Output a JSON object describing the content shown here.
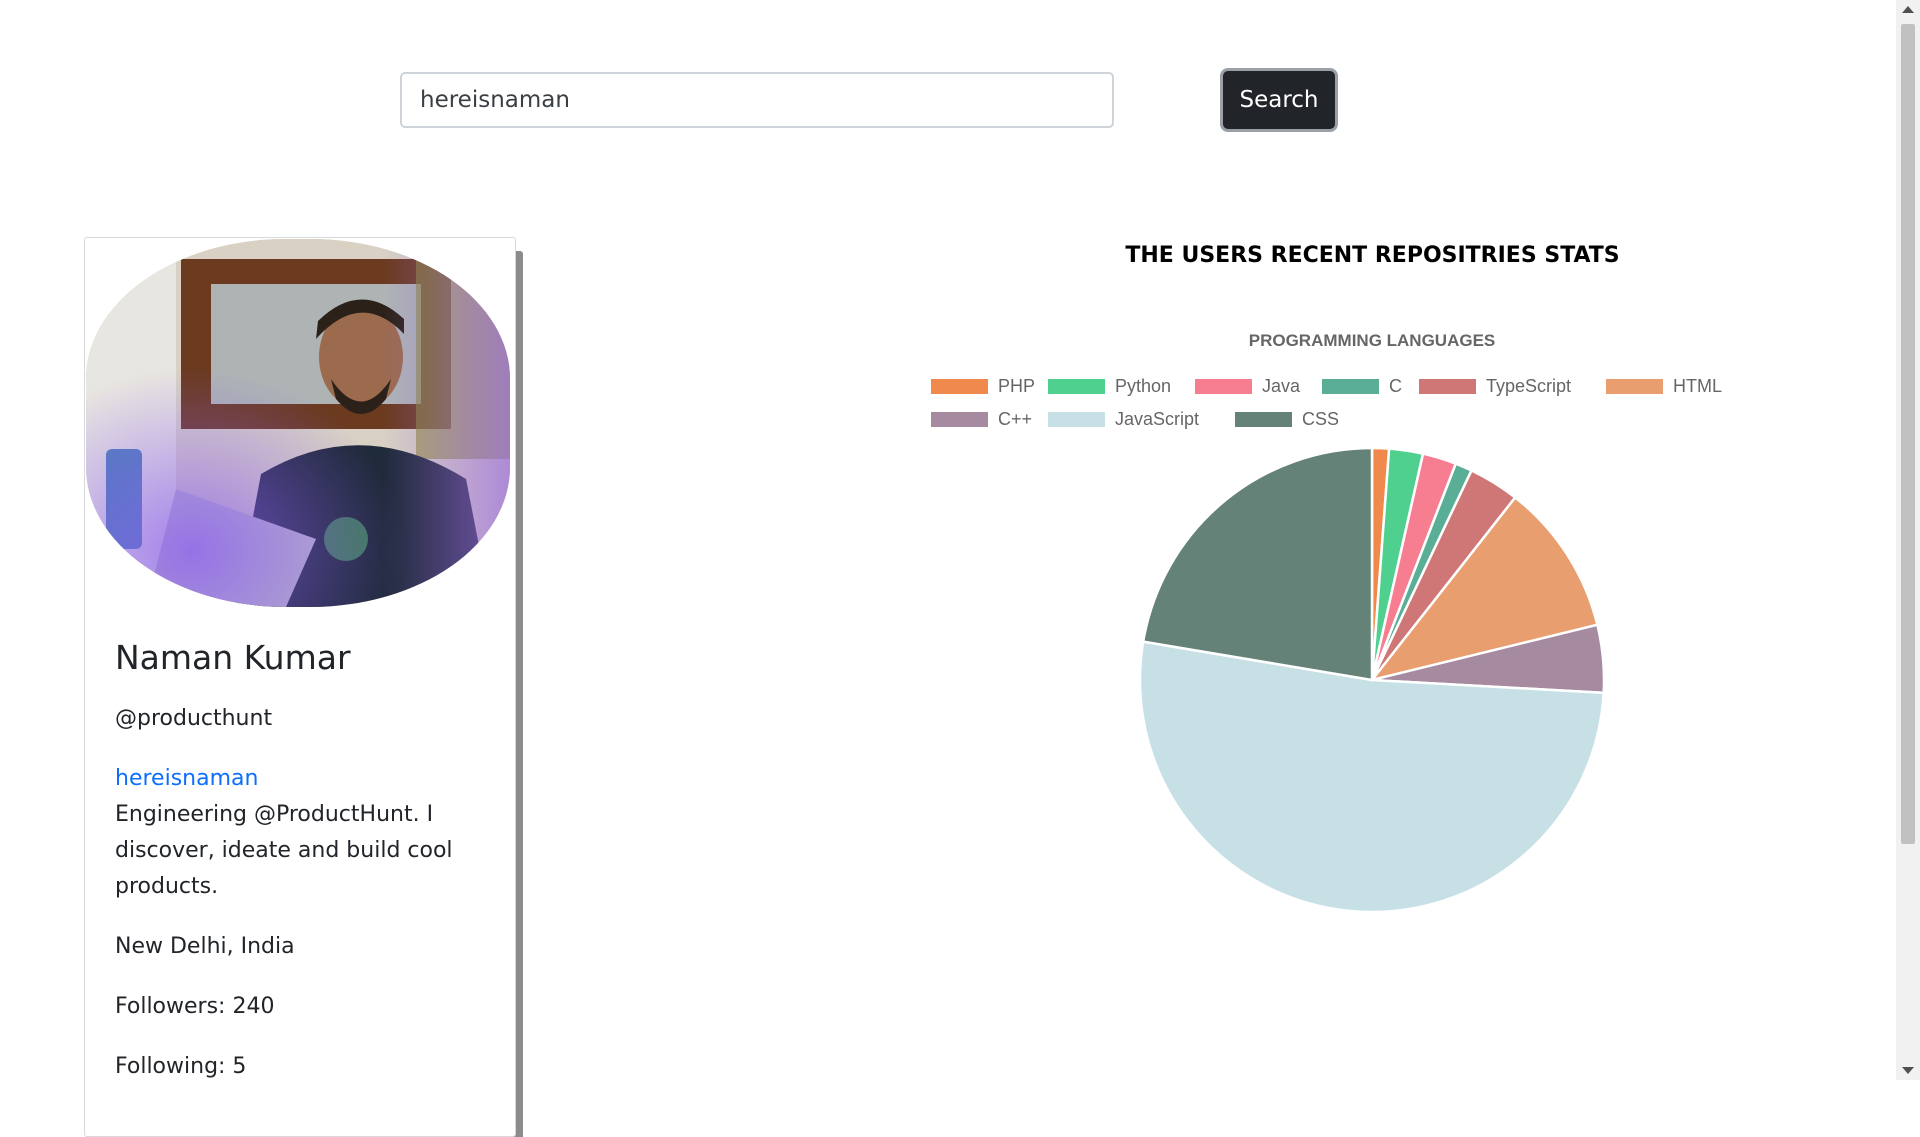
{
  "search": {
    "value": "hereisnaman",
    "button_label": "Search"
  },
  "profile": {
    "avatar_icon": "user-photo",
    "name": "Naman Kumar",
    "company": "@producthunt",
    "login": "hereisnaman",
    "bio": "Engineering @ProductHunt. I discover, ideate and build cool products.",
    "location": "New Delhi, India",
    "followers": "Followers: 240",
    "following": "Following: 5"
  },
  "stats": {
    "heading": "THE USERS RECENT REPOSITRIES STATS"
  },
  "chart_data": {
    "type": "pie",
    "title": "PROGRAMMING LANGUAGES",
    "legend_position": "top",
    "categories": [
      "PHP",
      "Python",
      "Java",
      "C",
      "TypeScript",
      "HTML",
      "C++",
      "JavaScript",
      "CSS"
    ],
    "values": [
      1,
      2,
      2,
      1,
      3,
      9,
      4,
      44,
      19
    ],
    "colors": [
      "#ef8a4c",
      "#4fd08f",
      "#f77e91",
      "#5aae96",
      "#cf7677",
      "#e89e6e",
      "#a68a9f",
      "#c6e0e6",
      "#648277"
    ]
  }
}
